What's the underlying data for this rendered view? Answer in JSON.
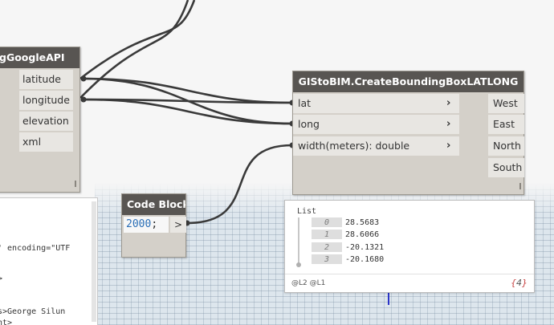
{
  "google_node": {
    "title": "gGoogleAPI",
    "outputs": [
      "latitude",
      "longitude",
      "elevation",
      "xml"
    ]
  },
  "gis_node": {
    "title": "GIStoBIM.CreateBoundingBoxLATLONG",
    "inputs": [
      "lat",
      "long",
      "width(meters): double"
    ],
    "outputs": [
      "West",
      "East",
      "North",
      "South"
    ]
  },
  "code_block": {
    "title": "Code Block",
    "value": "2000",
    "terminator": ";",
    "output_port": ">"
  },
  "xml_panel": {
    "lines": [
      "' encoding=\"UTF",
      ">",
      "s>George Silun",
      "nt>"
    ]
  },
  "watch_list": {
    "title": "List",
    "items": [
      {
        "index": "0",
        "value": "28.5683"
      },
      {
        "index": "1",
        "value": "28.6066"
      },
      {
        "index": "2",
        "value": "-20.1321"
      },
      {
        "index": "3",
        "value": "-20.1680"
      }
    ],
    "levels": "@L2 @L1",
    "count_open": "{",
    "count": "4",
    "count_close": "}"
  },
  "colors": {
    "node_header": "#585552",
    "node_body": "#d4d0c9",
    "wire": "#3a3a3a",
    "number": "#2b6fb7",
    "axis_blue": "#2a34c8"
  },
  "icons": {
    "input_arrow": "chevron-right-icon"
  }
}
